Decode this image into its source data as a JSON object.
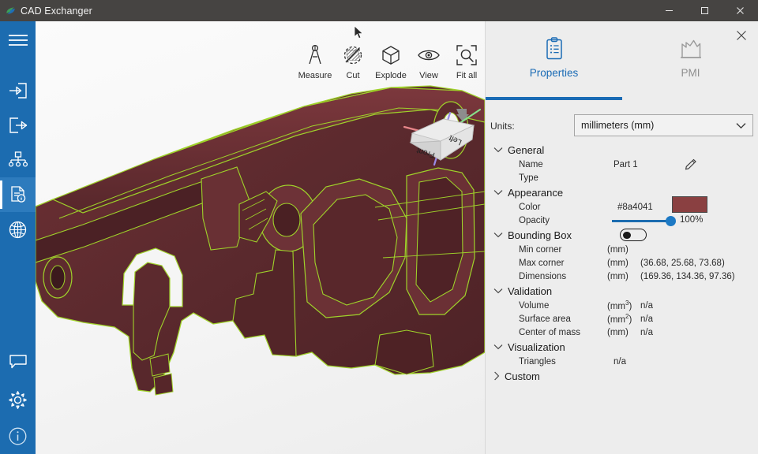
{
  "window": {
    "title": "CAD Exchanger",
    "logo_icon": "cad-exchanger-logo",
    "minimize_label": "–",
    "maximize_label": "☐",
    "close_label": "✕"
  },
  "sidebar": {
    "items": [
      {
        "name": "menu",
        "icon": "hamburger-menu-icon",
        "selected": false
      },
      {
        "name": "import",
        "icon": "import-arrow-icon",
        "selected": false
      },
      {
        "name": "export",
        "icon": "export-arrow-icon",
        "selected": false
      },
      {
        "name": "structure",
        "icon": "model-tree-icon",
        "selected": false
      },
      {
        "name": "properties",
        "icon": "document-properties-icon",
        "selected": true
      },
      {
        "name": "mesh",
        "icon": "globe-mesh-icon",
        "selected": false
      }
    ],
    "bottom_items": [
      {
        "name": "feedback",
        "icon": "speech-bubble-icon"
      },
      {
        "name": "settings",
        "icon": "gear-icon"
      },
      {
        "name": "about",
        "icon": "info-circle-icon"
      }
    ]
  },
  "toolbar": {
    "tools": [
      {
        "label": "Measure",
        "icon": "caliper-icon"
      },
      {
        "label": "Cut",
        "icon": "section-cut-icon"
      },
      {
        "label": "Explode",
        "icon": "cube-explode-icon"
      },
      {
        "label": "View",
        "icon": "eye-icon"
      },
      {
        "label": "Fit all",
        "icon": "zoom-fit-icon"
      }
    ]
  },
  "viewcube": {
    "front_label": "Front",
    "left_label": "Left",
    "axis_x_color": "#e8868a",
    "axis_y_color": "#86e08a",
    "axis_z_color": "#9a8ce8"
  },
  "model": {
    "fill_color": "#5e2a2e",
    "fill_color_light": "#7a3a3f",
    "edge_color": "#9fd22a"
  },
  "panel": {
    "close_icon": "close-icon",
    "tabs": [
      {
        "label": "Properties",
        "icon": "clipboard-properties-icon",
        "active": true
      },
      {
        "label": "PMI",
        "icon": "pmi-chart-icon",
        "active": false
      }
    ],
    "units": {
      "label": "Units:",
      "value": "millimeters (mm)",
      "chevron_icon": "chevron-down-icon"
    },
    "groups": [
      {
        "name": "General",
        "expanded": true,
        "chevron_icon": "chevron-down-icon",
        "rows": [
          {
            "name": "Name",
            "value": "Part 1",
            "unit": "",
            "edit_icon": "pencil-edit-icon"
          },
          {
            "name": "Type",
            "value": "",
            "unit": ""
          }
        ]
      },
      {
        "name": "Appearance",
        "expanded": true,
        "chevron_icon": "chevron-down-icon",
        "rows": [
          {
            "name": "Color",
            "value": "#8a4041",
            "unit": "",
            "swatch": "#8a4041"
          },
          {
            "name": "Opacity",
            "value": "100%",
            "unit": "",
            "slider": 100
          }
        ]
      },
      {
        "name": "Bounding Box",
        "expanded": true,
        "chevron_icon": "chevron-down-icon",
        "toggle_on": false,
        "rows": [
          {
            "name": "Min corner",
            "unit": "(mm)",
            "value": ""
          },
          {
            "name": "Max corner",
            "unit": "(mm)",
            "value": "(36.68, 25.68, 73.68)"
          },
          {
            "name": "Dimensions",
            "unit": "(mm)",
            "value": "(169.36, 134.36, 97.36)"
          }
        ]
      },
      {
        "name": "Validation",
        "expanded": true,
        "chevron_icon": "chevron-down-icon",
        "rows": [
          {
            "name": "Volume",
            "unit": "(mm3)",
            "value": "n/a"
          },
          {
            "name": "Surface area",
            "unit": "(mm2)",
            "value": "n/a"
          },
          {
            "name": "Center of mass",
            "unit": "(mm)",
            "value": "n/a"
          }
        ]
      },
      {
        "name": "Visualization",
        "expanded": true,
        "chevron_icon": "chevron-down-icon",
        "rows": [
          {
            "name": "Triangles",
            "unit": "",
            "value": "n/a"
          }
        ]
      },
      {
        "name": "Custom",
        "expanded": false,
        "chevron_icon": "chevron-right-icon",
        "rows": []
      }
    ]
  }
}
